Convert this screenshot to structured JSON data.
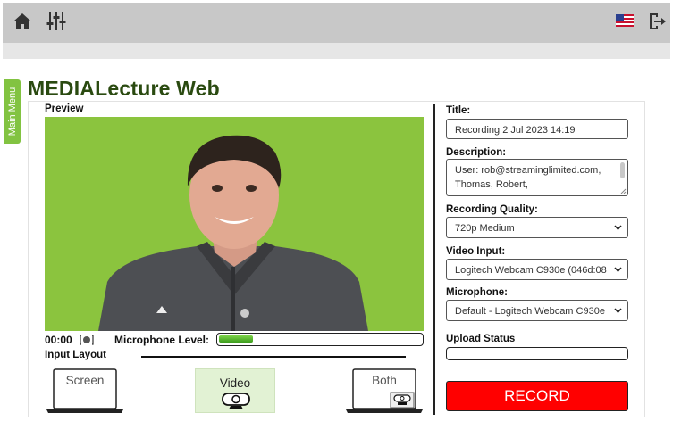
{
  "topbar": {
    "icons": {
      "home": "home-icon",
      "settings": "sliders-icon",
      "language": "us-flag-icon",
      "logout": "logout-icon"
    }
  },
  "main_menu": {
    "label": "Main Menu"
  },
  "app": {
    "title": "MEDIALecture Web"
  },
  "preview": {
    "label": "Preview",
    "timer": "00:00",
    "microphone_level_label": "Microphone Level:",
    "microphone_level": 0.17
  },
  "input_layout": {
    "label": "Input Layout",
    "options": [
      {
        "label": "Screen",
        "selected": false
      },
      {
        "label": "Video",
        "selected": true
      },
      {
        "label": "Both",
        "selected": false
      }
    ]
  },
  "form": {
    "title_label": "Title:",
    "title_value": "Recording 2 Jul 2023 14:19",
    "description_label": "Description:",
    "description_value": "User: rob@streaminglimited.com, Thomas, Robert,",
    "quality_label": "Recording Quality:",
    "quality_value": "720p Medium",
    "video_input_label": "Video Input:",
    "video_input_value": "Logitech Webcam C930e (046d:08",
    "microphone_label": "Microphone:",
    "microphone_value": "Default - Logitech Webcam C930e",
    "upload_status_label": "Upload Status",
    "upload_progress": 0,
    "record_label": "RECORD"
  },
  "colors": {
    "accent_green": "#82c341",
    "title_green": "#2a4a10",
    "record_red": "#ff0000",
    "video_background": "#8bc43e"
  }
}
